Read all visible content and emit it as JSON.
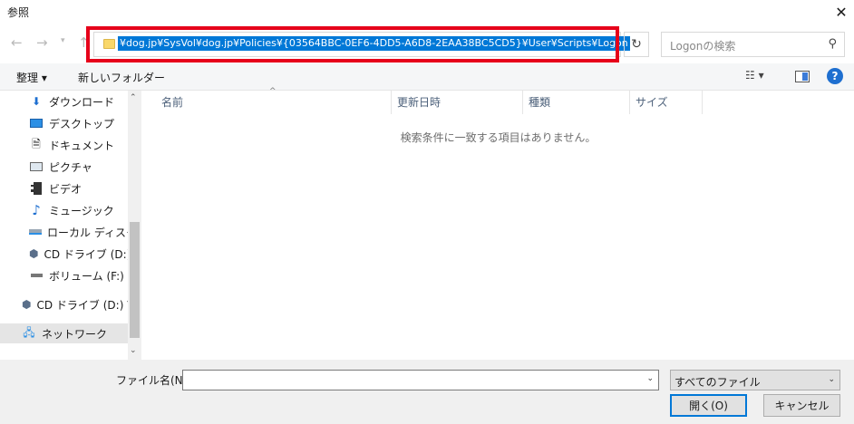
{
  "window": {
    "title": "参照"
  },
  "nav": {
    "address_path": "¥dog.jp¥SysVol¥dog.jp¥Policies¥{03564BBC-0EF6-4DD5-A6D8-2EAA38BC5CD5}¥User¥Scripts¥Logon",
    "search_placeholder": "Logonの検索"
  },
  "toolbar": {
    "organize": "整理 ▾",
    "new_folder": "新しいフォルダー"
  },
  "sidebar": {
    "items": [
      {
        "label": "ダウンロード",
        "icon": "download-icon"
      },
      {
        "label": "デスクトップ",
        "icon": "desktop-icon"
      },
      {
        "label": "ドキュメント",
        "icon": "document-icon"
      },
      {
        "label": "ピクチャ",
        "icon": "picture-icon"
      },
      {
        "label": "ビデオ",
        "icon": "video-icon"
      },
      {
        "label": "ミュージック",
        "icon": "music-icon"
      },
      {
        "label": "ローカル ディスク (C",
        "icon": "local-disk-icon"
      },
      {
        "label": "CD ドライブ (D:) Vi",
        "icon": "cd-drive-icon"
      },
      {
        "label": "ボリューム (F:)",
        "icon": "volume-icon"
      },
      {
        "label": "CD ドライブ (D:) Virt",
        "icon": "cd-drive-icon"
      },
      {
        "label": "ネットワーク",
        "icon": "network-icon"
      }
    ]
  },
  "columns": {
    "name": "名前",
    "modified": "更新日時",
    "type": "種類",
    "size": "サイズ"
  },
  "content": {
    "empty_message": "検索条件に一致する項目はありません。"
  },
  "bottom": {
    "filename_label": "ファイル名(N):",
    "filename_value": "",
    "filter": "すべてのファイル",
    "open_button": "開く(O)",
    "cancel_button": "キャンセル"
  },
  "colors": {
    "highlight_border": "#e6001a",
    "selection": "#0078d7",
    "help": "#1e6fd0"
  }
}
